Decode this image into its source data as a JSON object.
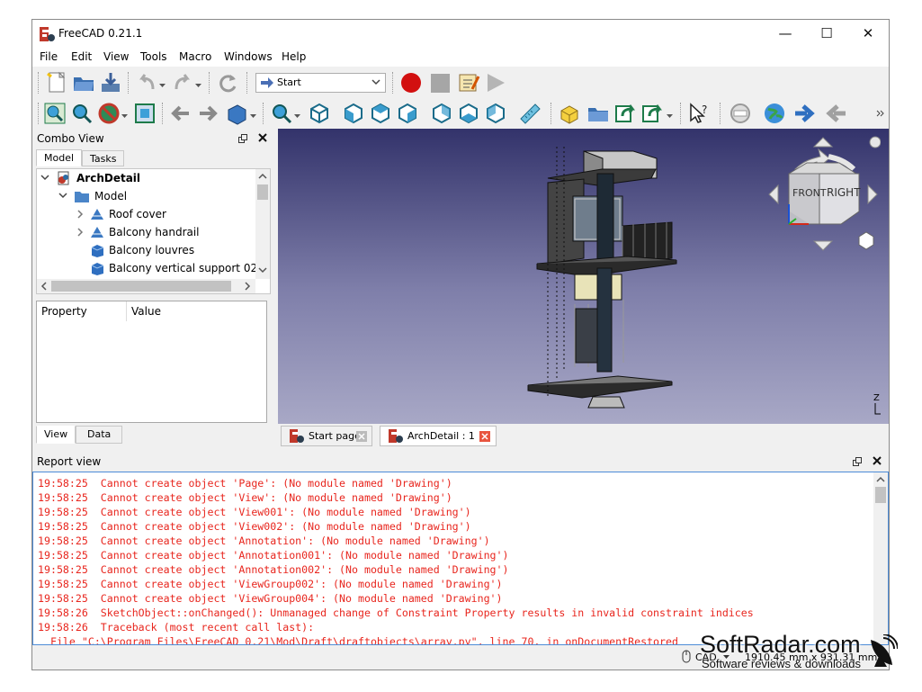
{
  "window": {
    "title": "FreeCAD 0.21.1",
    "minimize": "—",
    "maximize": "☐",
    "close": "✕"
  },
  "menu": [
    "File",
    "Edit",
    "View",
    "Tools",
    "Macro",
    "Windows",
    "Help"
  ],
  "workbench_selector": {
    "value": "Start"
  },
  "combo_view": {
    "title": "Combo View",
    "tabs": [
      "Model",
      "Tasks"
    ],
    "tree": {
      "root": "ArchDetail",
      "group": "Model",
      "items": [
        "Roof cover",
        "Balcony handrail",
        "Balcony louvres",
        "Balcony vertical support 02"
      ]
    },
    "property_header": {
      "col1": "Property",
      "col2": "Value"
    },
    "bottom_tabs": [
      "View",
      "Data"
    ]
  },
  "navcube": {
    "front": "FRONT",
    "right": "RIGHT"
  },
  "axis_label": "Z",
  "doc_tabs": [
    {
      "label": "Start page"
    },
    {
      "label": "ArchDetail : 1"
    }
  ],
  "report_view": {
    "title": "Report view",
    "lines": [
      "19:58:25  Cannot create object 'Page': (No module named 'Drawing')",
      "19:58:25  Cannot create object 'View': (No module named 'Drawing')",
      "19:58:25  Cannot create object 'View001': (No module named 'Drawing')",
      "19:58:25  Cannot create object 'View002': (No module named 'Drawing')",
      "19:58:25  Cannot create object 'Annotation': (No module named 'Drawing')",
      "19:58:25  Cannot create object 'Annotation001': (No module named 'Drawing')",
      "19:58:25  Cannot create object 'Annotation002': (No module named 'Drawing')",
      "19:58:25  Cannot create object 'ViewGroup002': (No module named 'Drawing')",
      "19:58:25  Cannot create object 'ViewGroup004': (No module named 'Drawing')",
      "19:58:26  SketchObject::onChanged(): Unmanaged change of Constraint Property results in invalid constraint indices",
      "19:58:26  Traceback (most recent call last):",
      "  File \"C:\\Program Files\\FreeCAD 0.21\\Mod\\Draft\\draftobjects\\array.py\", line 70, in onDocumentRestored"
    ]
  },
  "statusbar": {
    "nav_style": "CAD",
    "dimensions": "1910.45 mm x 931.31 mm"
  },
  "watermark": {
    "brand": "SoftRadar.com",
    "tagline": "Software reviews & downloads"
  }
}
